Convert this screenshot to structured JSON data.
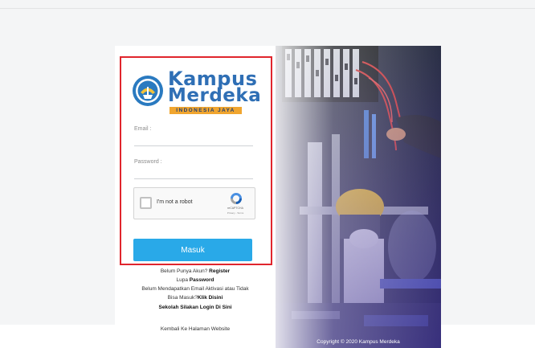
{
  "brand": {
    "line1": "Kampus",
    "line2": "Merdeka",
    "tagline": "INDONESIA JAYA"
  },
  "form": {
    "email_label": "Email :",
    "password_label": "Password :",
    "recaptcha_label": "I'm not a robot",
    "recaptcha_brand": "reCAPTCHA",
    "recaptcha_terms": "Privacy - Terms",
    "submit_label": "Masuk"
  },
  "links": {
    "register_prefix": "Belum Punya Akun?",
    "register_link": "Register",
    "forgot_prefix": "Lupa",
    "forgot_link": "Password",
    "activation_line1": "Belum Mendapatkan Email Aktivasi atau Tidak",
    "activation_line2_prefix": "Bisa Masuk?",
    "activation_link": "Klik Disini",
    "school_login": "Sekolah Silakan Login Di Sini",
    "back_to_website": "Kembali Ke Halaman Website"
  },
  "footer": {
    "copyright": "Copyright © 2020 Kampus Merdeka"
  },
  "colors": {
    "highlight_border": "#e0252d",
    "primary_button": "#29a9e8",
    "brand_blue": "#2f6fb5",
    "brand_orange": "#f0a52f"
  },
  "icons": {
    "emblem": "tut-wuri-handayani-emblem",
    "recaptcha": "recaptcha-logo-icon",
    "checkbox": "checkbox-icon"
  }
}
